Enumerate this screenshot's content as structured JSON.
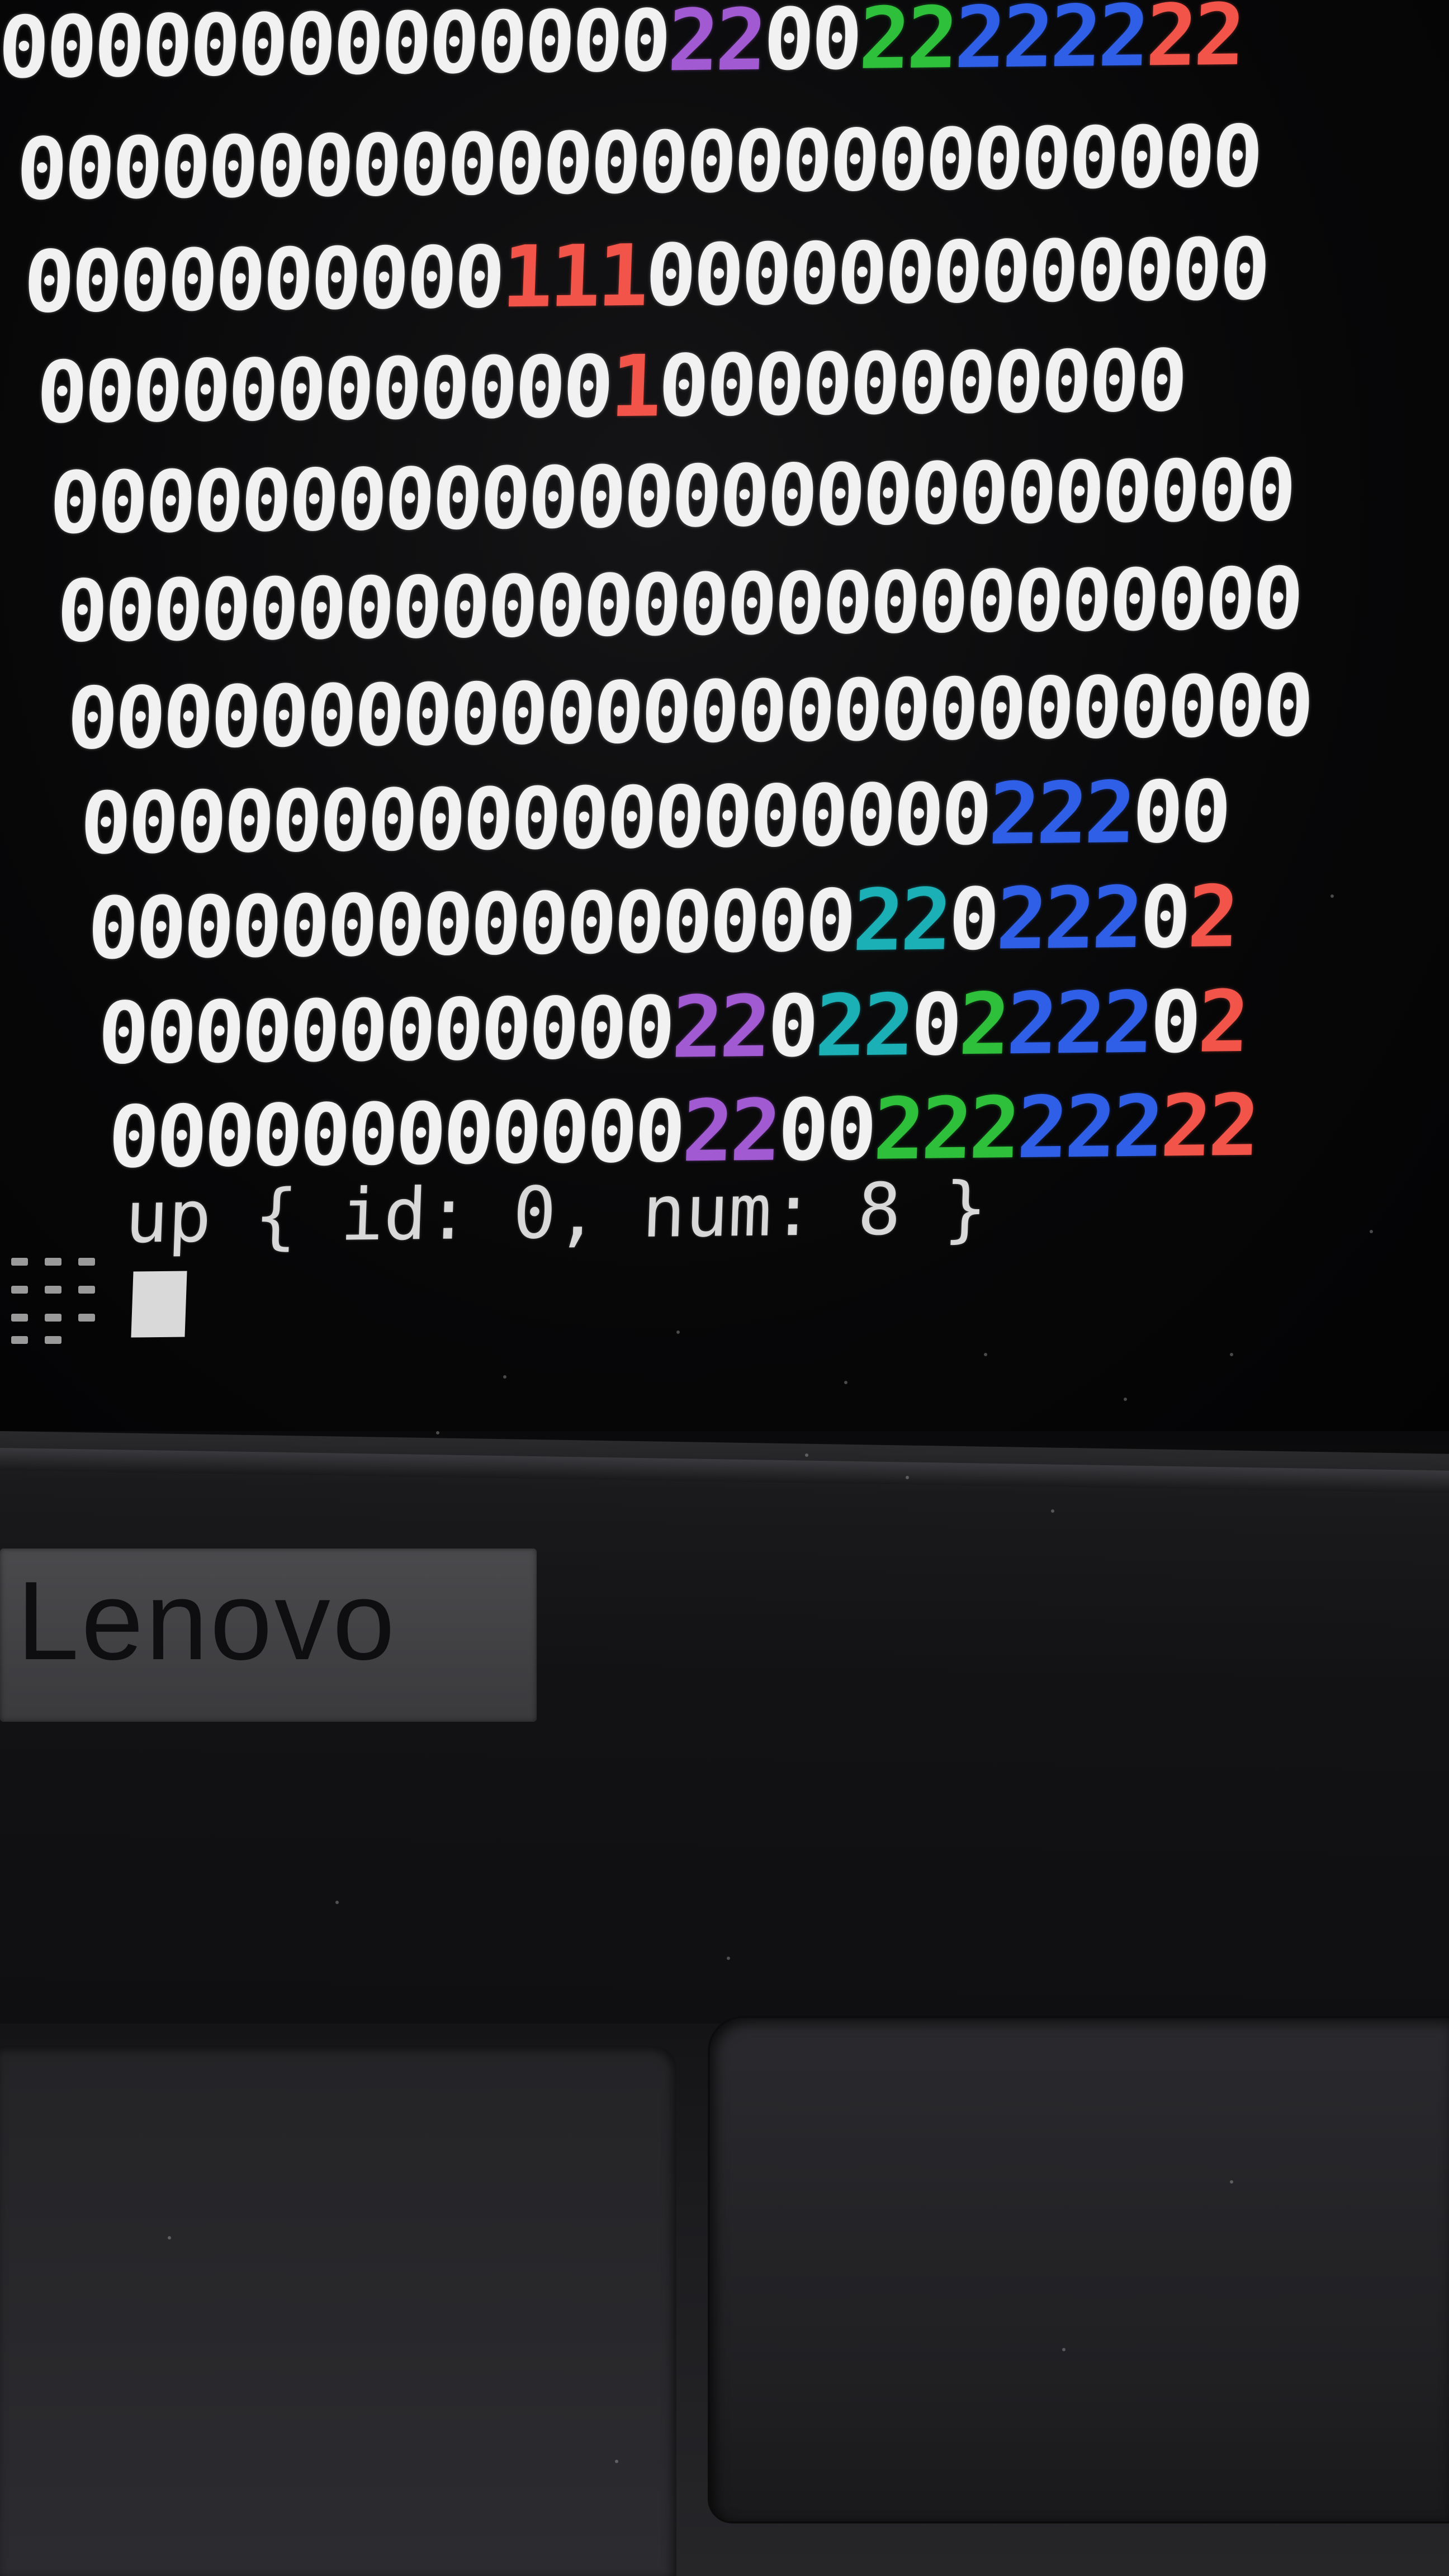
{
  "grid": {
    "rows": [
      [
        [
          "00000000000000",
          "white"
        ],
        [
          "22",
          "purple"
        ],
        [
          "00",
          "white"
        ],
        [
          "22",
          "green"
        ],
        [
          "2222",
          "blue"
        ],
        [
          "22",
          "red"
        ]
      ],
      [
        [
          "00000000000000000000000000",
          "white"
        ]
      ],
      [
        [
          "0000000000",
          "white"
        ],
        [
          "111",
          "red"
        ],
        [
          "0000000000000",
          "white"
        ]
      ],
      [
        [
          "000000000000",
          "white"
        ],
        [
          "1",
          "red"
        ],
        [
          "00000000000",
          "white"
        ]
      ],
      [
        [
          "00000000000000000000000000",
          "white"
        ]
      ],
      [
        [
          "00000000000000000000000000",
          "white"
        ]
      ],
      [
        [
          "00000000000000000000000000",
          "white"
        ]
      ],
      [
        [
          "0000000000000000000",
          "white"
        ],
        [
          "222",
          "blue"
        ],
        [
          "00",
          "white"
        ]
      ],
      [
        [
          "0000000000000000",
          "white"
        ],
        [
          "22",
          "cyan"
        ],
        [
          "0",
          "white"
        ],
        [
          "222",
          "blue"
        ],
        [
          "0",
          "white"
        ],
        [
          "2",
          "red"
        ]
      ],
      [
        [
          "000000000000",
          "white"
        ],
        [
          "22",
          "purple"
        ],
        [
          "0",
          "white"
        ],
        [
          "22",
          "cyan"
        ],
        [
          "0",
          "white"
        ],
        [
          "2",
          "green"
        ],
        [
          "222",
          "blue"
        ],
        [
          "0",
          "white"
        ],
        [
          "2",
          "red"
        ]
      ],
      [
        [
          "000000000000",
          "white"
        ],
        [
          "22",
          "purple"
        ],
        [
          "00",
          "white"
        ],
        [
          "222",
          "green"
        ],
        [
          "222",
          "blue"
        ],
        [
          "22",
          "red"
        ]
      ]
    ]
  },
  "prompt": {
    "text": "up { id: 0, num: 8 }"
  },
  "laptop": {
    "brand": "Lenovo"
  },
  "colors": {
    "white": "#f1f1f1",
    "red": "#f2544a",
    "purple": "#a25ad3",
    "green": "#2ec03a",
    "blue": "#2f5fe6",
    "cyan": "#1bb0b5",
    "background": "#0b0b0c"
  },
  "icons": {
    "keypad": "keypad-grid-icon"
  }
}
